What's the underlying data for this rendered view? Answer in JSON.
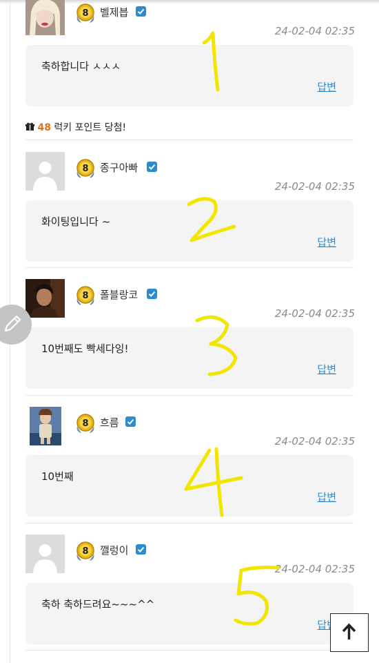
{
  "colors": {
    "reply_link": "#2b8ccf",
    "lucky_points": "#e0711c",
    "badge_gold": "#e8b418",
    "verified_blue": "#2b8ccf",
    "handwriting": "#f2e600"
  },
  "level_badge_text": "8",
  "comments": [
    {
      "author": "벨제븝",
      "timestamp": "24-02-04 02:35",
      "text": "축하합니다 ㅅㅅㅅ",
      "reply_label": "답변",
      "avatar": "photo-blonde-woman",
      "handwritten_number": "1"
    },
    {
      "author": "종구아빠",
      "timestamp": "24-02-04 02:35",
      "text": "화이팅입니다 ~",
      "reply_label": "답변",
      "avatar": "default-user-icon",
      "handwritten_number": "2"
    },
    {
      "author": "폴블랑코",
      "timestamp": "24-02-04 02:35",
      "text": "10번째도 빡세다잉!",
      "reply_label": "답변",
      "avatar": "photo-man-dark",
      "handwritten_number": "3"
    },
    {
      "author": "흐름",
      "timestamp": "24-02-04 02:35",
      "text": "10번째",
      "reply_label": "답변",
      "avatar": "photo-child-figure",
      "handwritten_number": "4"
    },
    {
      "author": "깰렁이",
      "timestamp": "24-02-04 02:35",
      "text": "축하 축하드려요~~~^^",
      "reply_label": "답변",
      "avatar": "default-user-icon",
      "handwritten_number": "5"
    }
  ],
  "lucky_point": {
    "icon": "gift-icon",
    "points": "48",
    "text": " 럭키 포인트 당첨!"
  },
  "floating": {
    "edit_icon": "pencil-icon",
    "scroll_top_icon": "arrow-up-icon"
  }
}
